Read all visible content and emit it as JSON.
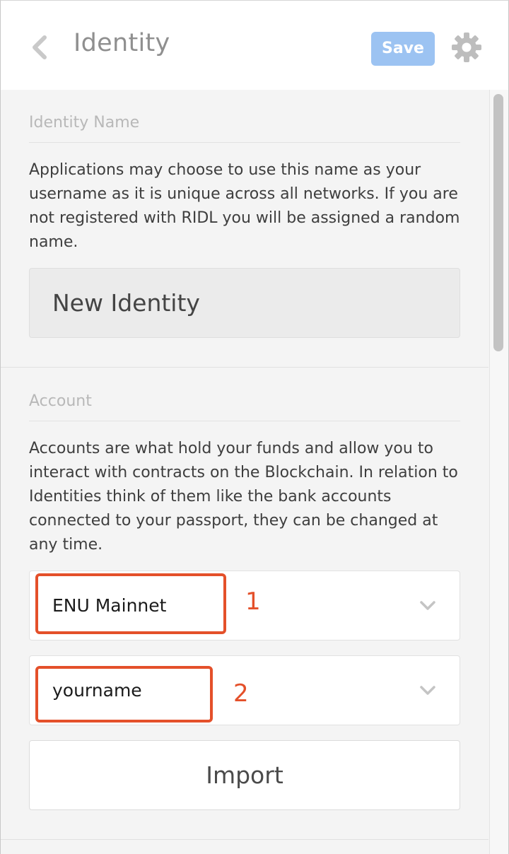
{
  "header": {
    "title": "Identity",
    "save_label": "Save",
    "back_icon": "chevron-left-icon",
    "settings_icon": "gear-icon"
  },
  "identity_section": {
    "label": "Identity Name",
    "description": "Applications may choose to use this name as your username as it is unique across all networks. If you are not registered with RIDL you will be assigned a random name.",
    "name_value": "New Identity"
  },
  "account_section": {
    "label": "Account",
    "description": "Accounts are what hold your funds and allow you to interact with contracts on the Blockchain. In relation to Identities think of them like the bank accounts connected to your passport, they can be changed at any time.",
    "network_select": {
      "value": "ENU Mainnet",
      "annotation": "1"
    },
    "account_select": {
      "value": "yourname",
      "annotation": "2"
    },
    "import_label": "Import"
  },
  "colors": {
    "save_button": "#9cc3f2",
    "highlight": "#e4502a",
    "title_text": "#8f8f8f",
    "content_bg": "#f4f4f4"
  }
}
